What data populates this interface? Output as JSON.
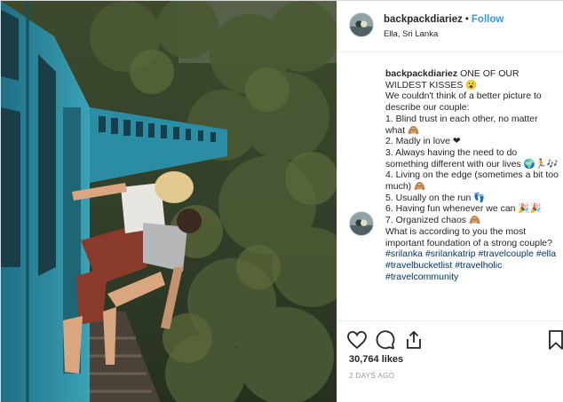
{
  "post": {
    "username": "backpackdiariez",
    "separator": "•",
    "follow_label": "Follow",
    "location": "Ella, Sri Lanka",
    "image_alt": "Couple kissing while leaning out of a blue train passing through a forest"
  },
  "caption": {
    "username": "backpackdiariez",
    "lines": [
      "ONE OF OUR WILDEST KISSES 😮",
      "We couldn't think of a better picture to describe our couple:",
      "1. Blind trust in each other, no matter what 🙈",
      "2. Madly in love ❤",
      "3. Always having the need to do something different with our lives 🌍🏃🎶",
      "4. Living on the edge (sometimes a bit too much) 🙈",
      "5. Usually on the run 👣",
      "6. Having fun whenever we can 🎉🎉",
      "7. Organized chaos 🙈",
      "What is according to you the most important foundation of a strong couple?"
    ],
    "hashtags": [
      "#srilanka",
      "#srilankatrip",
      "#travelcouple",
      "#ella",
      "#travelbucketlist",
      "#travelholic",
      "#travelcommunity"
    ]
  },
  "actions": {
    "like_icon": "heart-icon",
    "comment_icon": "speech-bubble-icon",
    "share_icon": "share-upload-icon",
    "save_icon": "bookmark-icon"
  },
  "likes": {
    "text": "30,764 likes"
  },
  "timestamp": {
    "text": "2 DAYS AGO"
  },
  "colors": {
    "link": "#3897f0",
    "hashtag": "#003569",
    "text": "#262626",
    "muted": "#999999",
    "train": "#2b8da3"
  }
}
